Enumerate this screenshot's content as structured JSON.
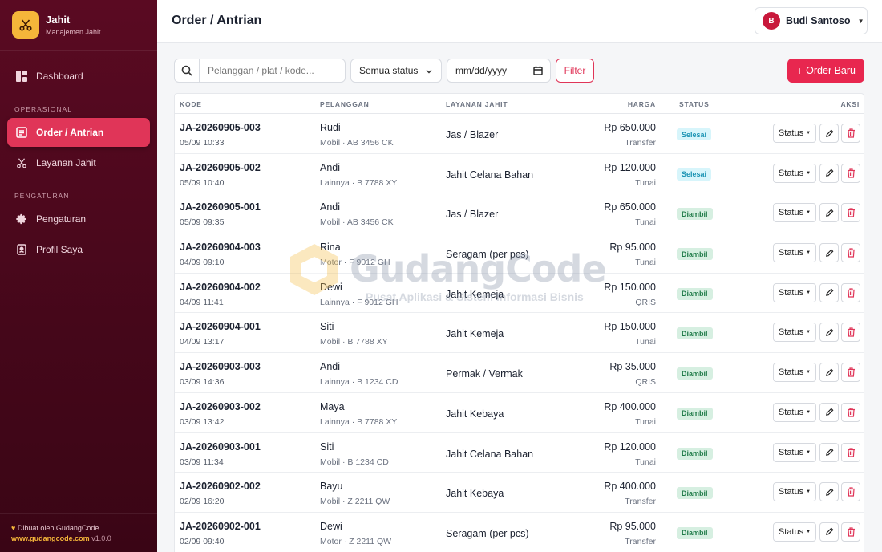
{
  "brand": {
    "name": "Jahit",
    "subtitle": "Manajemen Jahit"
  },
  "sidebar": {
    "items_main": [
      {
        "label": "Dashboard",
        "icon": "dashboard-icon"
      }
    ],
    "section_operasional": "OPERASIONAL",
    "items_operasional": [
      {
        "label": "Order / Antrian",
        "icon": "order-list-icon",
        "active": true
      },
      {
        "label": "Layanan Jahit",
        "icon": "scissors-icon",
        "active": false
      }
    ],
    "section_pengaturan": "PENGATURAN",
    "items_pengaturan": [
      {
        "label": "Pengaturan",
        "icon": "gear-icon"
      },
      {
        "label": "Profil Saya",
        "icon": "profile-icon"
      }
    ],
    "footer": {
      "credit": "Dibuat oleh GudangCode",
      "url": "www.gudangcode.com",
      "version": "v1.0.0"
    }
  },
  "header": {
    "title": "Order / Antrian",
    "user": {
      "initial": "B",
      "name": "Budi Santoso"
    }
  },
  "filters": {
    "search_placeholder": "Pelanggan / plat / kode...",
    "status_value": "Semua status",
    "date_placeholder": "mm/dd/yyyy",
    "filter_label": "Filter",
    "new_order_label": "Order Baru"
  },
  "table": {
    "headers": {
      "kode": "KODE",
      "pelanggan": "PELANGGAN",
      "layanan": "LAYANAN JAHIT",
      "harga": "HARGA",
      "status": "STATUS",
      "aksi": "AKSI"
    },
    "action_status_label": "Status",
    "rows": [
      {
        "code": "JA-20260905-003",
        "time": "05/09 10:33",
        "customer": "Rudi",
        "vehicle": "Mobil · AB 3456 CK",
        "service": "Jas / Blazer",
        "price": "Rp 650.000",
        "payment": "Transfer",
        "status": "Selesai"
      },
      {
        "code": "JA-20260905-002",
        "time": "05/09 10:40",
        "customer": "Andi",
        "vehicle": "Lainnya · B 7788 XY",
        "service": "Jahit Celana Bahan",
        "price": "Rp 120.000",
        "payment": "Tunai",
        "status": "Selesai"
      },
      {
        "code": "JA-20260905-001",
        "time": "05/09 09:35",
        "customer": "Andi",
        "vehicle": "Mobil · AB 3456 CK",
        "service": "Jas / Blazer",
        "price": "Rp 650.000",
        "payment": "Tunai",
        "status": "Diambil"
      },
      {
        "code": "JA-20260904-003",
        "time": "04/09 09:10",
        "customer": "Rina",
        "vehicle": "Motor · F 9012 GH",
        "service": "Seragam (per pcs)",
        "price": "Rp 95.000",
        "payment": "Tunai",
        "status": "Diambil"
      },
      {
        "code": "JA-20260904-002",
        "time": "04/09 11:41",
        "customer": "Dewi",
        "vehicle": "Lainnya · F 9012 GH",
        "service": "Jahit Kemeja",
        "price": "Rp 150.000",
        "payment": "QRIS",
        "status": "Diambil"
      },
      {
        "code": "JA-20260904-001",
        "time": "04/09 13:17",
        "customer": "Siti",
        "vehicle": "Mobil · B 7788 XY",
        "service": "Jahit Kemeja",
        "price": "Rp 150.000",
        "payment": "Tunai",
        "status": "Diambil"
      },
      {
        "code": "JA-20260903-003",
        "time": "03/09 14:36",
        "customer": "Andi",
        "vehicle": "Lainnya · B 1234 CD",
        "service": "Permak / Vermak",
        "price": "Rp 35.000",
        "payment": "QRIS",
        "status": "Diambil"
      },
      {
        "code": "JA-20260903-002",
        "time": "03/09 13:42",
        "customer": "Maya",
        "vehicle": "Lainnya · B 7788 XY",
        "service": "Jahit Kebaya",
        "price": "Rp 400.000",
        "payment": "Tunai",
        "status": "Diambil"
      },
      {
        "code": "JA-20260903-001",
        "time": "03/09 11:34",
        "customer": "Siti",
        "vehicle": "Mobil · B 1234 CD",
        "service": "Jahit Celana Bahan",
        "price": "Rp 120.000",
        "payment": "Tunai",
        "status": "Diambil"
      },
      {
        "code": "JA-20260902-002",
        "time": "02/09 16:20",
        "customer": "Bayu",
        "vehicle": "Mobil · Z 2211 QW",
        "service": "Jahit Kebaya",
        "price": "Rp 400.000",
        "payment": "Transfer",
        "status": "Diambil"
      },
      {
        "code": "JA-20260902-001",
        "time": "02/09 09:40",
        "customer": "Dewi",
        "vehicle": "Motor · Z 2211 QW",
        "service": "Seragam (per pcs)",
        "price": "Rp 95.000",
        "payment": "Transfer",
        "status": "Diambil"
      }
    ]
  },
  "watermark": {
    "title": "GudangCode",
    "subtitle": "Pusat Aplikasi & Sistem Informasi Bisnis"
  },
  "colors": {
    "accent": "#e8274f",
    "sidebar": "#4f0a1f",
    "brand_logo": "#f5b63a",
    "status_selesai": "#1b93b3",
    "status_diambil": "#1f7a48"
  }
}
